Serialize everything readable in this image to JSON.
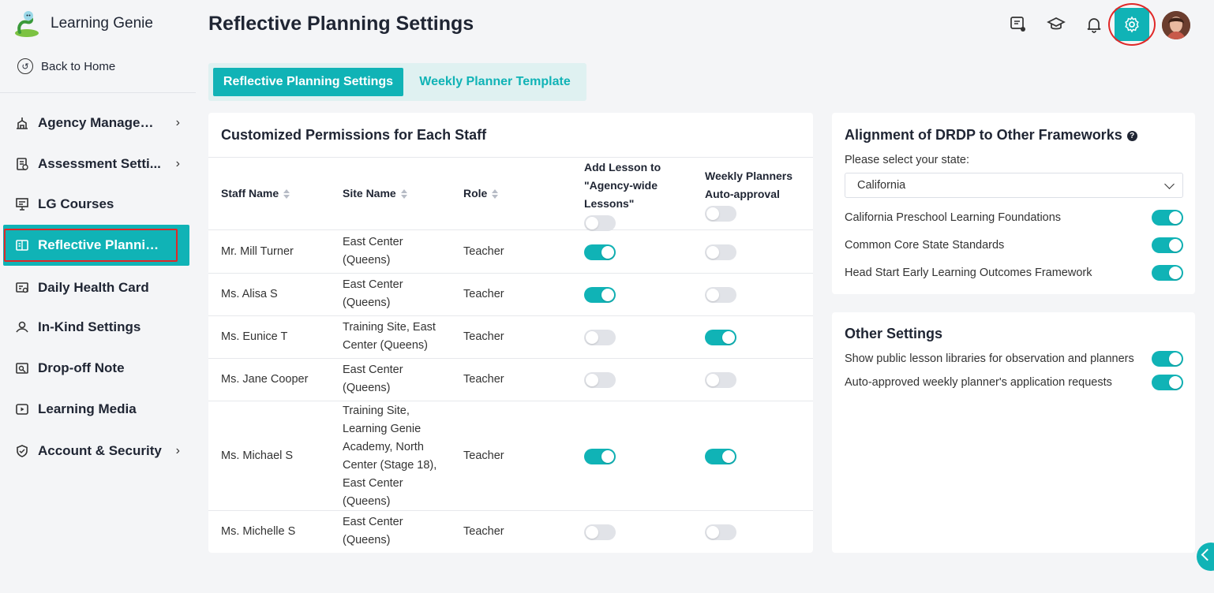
{
  "app": {
    "name": "Learning Genie",
    "back_label": "Back to Home"
  },
  "page_title": "Reflective Planning Settings",
  "sidebar": {
    "items": [
      {
        "label": "Agency Managem...",
        "icon": "agency-icon",
        "has_chevron": true
      },
      {
        "label": "Assessment Setti...",
        "icon": "assessment-icon",
        "has_chevron": true
      },
      {
        "label": "LG Courses",
        "icon": "courses-icon",
        "has_chevron": false
      },
      {
        "label": "Reflective Plannin...",
        "icon": "book-icon",
        "has_chevron": false,
        "active": true
      },
      {
        "label": "Daily Health Card",
        "icon": "health-card-icon",
        "has_chevron": false
      },
      {
        "label": "In-Kind Settings",
        "icon": "in-kind-icon",
        "has_chevron": false
      },
      {
        "label": "Drop-off Note",
        "icon": "note-icon",
        "has_chevron": false
      },
      {
        "label": "Learning Media",
        "icon": "media-icon",
        "has_chevron": false
      },
      {
        "label": "Account & Security",
        "icon": "shield-icon",
        "has_chevron": true
      }
    ]
  },
  "tabs": [
    {
      "label": "Reflective Planning Settings",
      "active": true
    },
    {
      "label": "Weekly Planner Template",
      "active": false
    }
  ],
  "permissions": {
    "title": "Customized Permissions for Each Staff",
    "headers": {
      "staff": "Staff Name",
      "site": "Site Name",
      "role": "Role",
      "add_lesson": "Add Lesson to \"Agency-wide Lessons\"",
      "auto_approval": "Weekly Planners Auto-approval"
    },
    "header_toggles": {
      "add_lesson": false,
      "auto_approval": false
    },
    "rows": [
      {
        "staff": "Mr. Mill Turner",
        "site": "East Center (Queens)",
        "role": "Teacher",
        "add_lesson": true,
        "auto_approval": false
      },
      {
        "staff": "Ms. Alisa S",
        "site": "East Center (Queens)",
        "role": "Teacher",
        "add_lesson": true,
        "auto_approval": false
      },
      {
        "staff": "Ms. Eunice T",
        "site": "Training Site, East Center (Queens)",
        "role": "Teacher",
        "add_lesson": false,
        "auto_approval": true
      },
      {
        "staff": "Ms. Jane Cooper",
        "site": "East Center (Queens)",
        "role": "Teacher",
        "add_lesson": false,
        "auto_approval": false
      },
      {
        "staff": "Ms. Michael S",
        "site": "Training Site, Learning Genie Academy, North Center (Stage 18), East Center (Queens)",
        "role": "Teacher",
        "add_lesson": true,
        "auto_approval": true
      },
      {
        "staff": "Ms. Michelle S",
        "site": "East Center (Queens)",
        "role": "Teacher",
        "add_lesson": false,
        "auto_approval": false
      }
    ]
  },
  "alignment": {
    "title": "Alignment of DRDP to Other Frameworks",
    "help_glyph": "?",
    "state_label": "Please select your state:",
    "state_value": "California",
    "frameworks": [
      {
        "label": "California Preschool Learning Foundations",
        "on": true
      },
      {
        "label": "Common Core State Standards",
        "on": true
      },
      {
        "label": "Head Start Early Learning Outcomes Framework",
        "on": true
      }
    ]
  },
  "other_settings": {
    "title": "Other Settings",
    "items": [
      {
        "label": "Show public lesson libraries for observation and planners",
        "on": true
      },
      {
        "label": "Auto-approved weekly planner's application requests",
        "on": true
      }
    ]
  },
  "colors": {
    "accent": "#10b3b6",
    "highlight": "#e02828",
    "toggle_off": "#e1e3e8"
  }
}
